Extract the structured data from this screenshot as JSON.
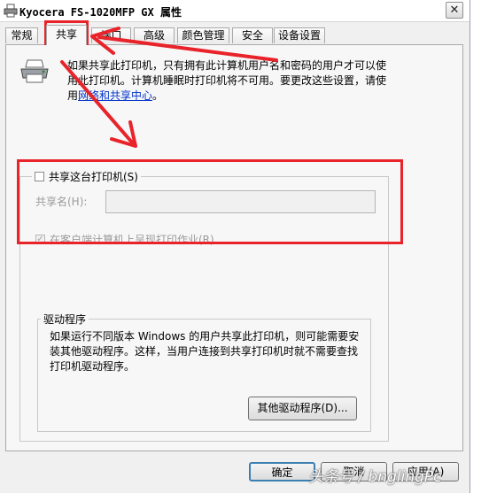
{
  "window": {
    "title": "Kyocera FS-1020MFP GX 属性",
    "close_glyph": "✕"
  },
  "tabs": [
    {
      "label": "常规"
    },
    {
      "label": "共享"
    },
    {
      "label": "端口"
    },
    {
      "label": "高级"
    },
    {
      "label": "颜色管理"
    },
    {
      "label": "安全"
    },
    {
      "label": "设备设置"
    }
  ],
  "active_tab": "共享",
  "info": {
    "text_before_link": "如果共享此打印机，只有拥有此计算机用户名和密码的用户才可以使用此打印机。计算机睡眠时打印机将不可用。要更改这些设置，请使用",
    "link_text": "网络和共享中心",
    "text_after_link": "。"
  },
  "sharing": {
    "share_checkbox_label": "共享这台打印机(S)",
    "share_checked": false,
    "share_name_label": "共享名(H):",
    "share_name_value": "",
    "render_jobs_label": "在客户端计算机上呈现打印作业(R)",
    "render_jobs_checked": true
  },
  "drivers": {
    "legend": "驱动程序",
    "description": "如果运行不同版本 Windows 的用户共享此打印机，则可能需要安装其他驱动程序。这样，当用户连接到共享打印机时就不需要查找打印机驱动程序。",
    "additional_button": "其他驱动程序(D)..."
  },
  "footer": {
    "ok": "确定",
    "cancel": "取消",
    "apply": "应用(A)"
  },
  "annotations": {
    "color": "#e8232a"
  },
  "watermark": "头条号 / bnglingPc"
}
